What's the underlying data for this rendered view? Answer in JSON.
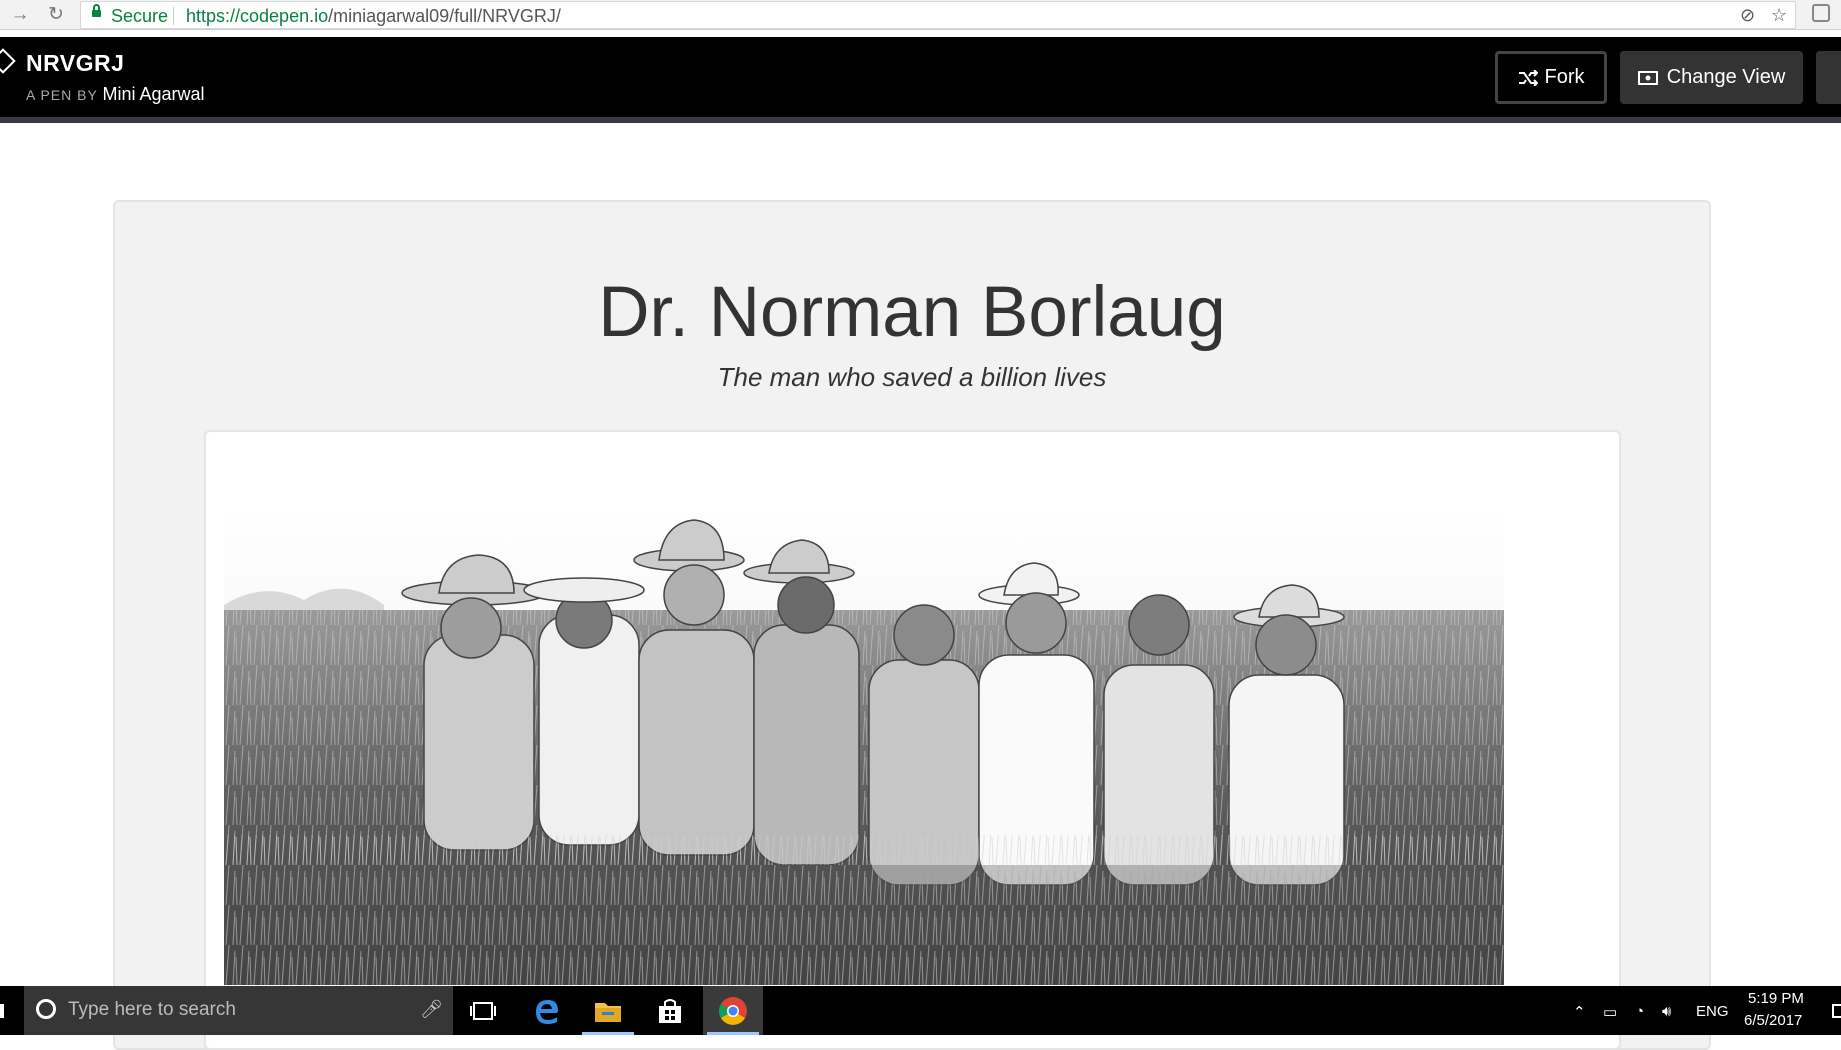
{
  "browser": {
    "secure_label": "Secure",
    "url_host": "https://codepen.io",
    "url_path": "/miniagarwal09/full/NRVGRJ/"
  },
  "header": {
    "pen_title": "NRVGRJ",
    "pen_by": "A PEN BY",
    "author": "Mini Agarwal",
    "fork_label": "Fork",
    "change_view_label": "Change View"
  },
  "content": {
    "title": "Dr. Norman Borlaug",
    "subtitle": "The man who saved a billion lives",
    "image_alt": "Black and white photograph of eight men standing in a wheat field"
  },
  "taskbar": {
    "search_placeholder": "Type here to search",
    "language": "ENG",
    "time": "5:19 PM",
    "date": "6/5/2017"
  }
}
